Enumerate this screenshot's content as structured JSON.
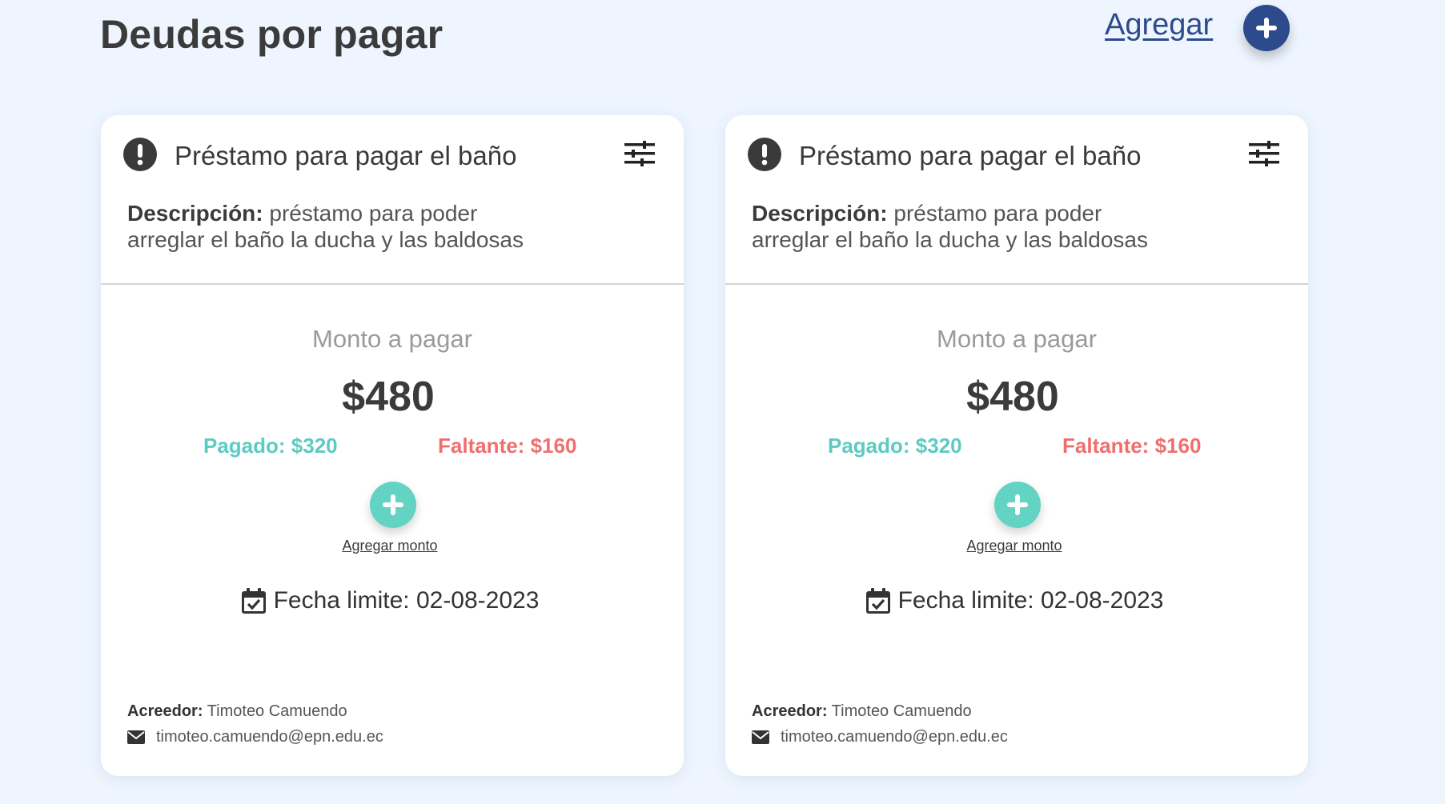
{
  "page": {
    "title": "Deudas por pagar",
    "add_link": "Agregar"
  },
  "colors": {
    "primary": "#2c4a8c",
    "paid": "#5ccbc0",
    "missing": "#ef6f6f",
    "add_amount": "#63d3c4",
    "background": "#eef5fe"
  },
  "cards": [
    {
      "title": "Préstamo para pagar el baño",
      "desc_label": "Descripción:",
      "desc_text": " préstamo para poder arreglar el baño la ducha y las baldosas",
      "amount_label": "Monto a pagar",
      "amount": "$480",
      "paid": "Pagado: $320",
      "missing": "Faltante: $160",
      "add_amount_label": "Agregar monto",
      "due": "Fecha limite: 02-08-2023",
      "creditor_label": "Acreedor:",
      "creditor_name": " Timoteo Camuendo",
      "email": "timoteo.camuendo@epn.edu.ec"
    },
    {
      "title": "Préstamo para pagar el baño",
      "desc_label": "Descripción:",
      "desc_text": " préstamo para poder arreglar el baño la ducha y las baldosas",
      "amount_label": "Monto a pagar",
      "amount": "$480",
      "paid": "Pagado: $320",
      "missing": "Faltante: $160",
      "add_amount_label": "Agregar monto",
      "due": "Fecha limite: 02-08-2023",
      "creditor_label": "Acreedor:",
      "creditor_name": " Timoteo Camuendo",
      "email": "timoteo.camuendo@epn.edu.ec"
    }
  ],
  "icons": {
    "alert": "exclamation-circle-icon",
    "settings": "sliders-icon",
    "plus": "plus-icon",
    "calendar": "calendar-check-icon",
    "email": "envelope-icon"
  }
}
